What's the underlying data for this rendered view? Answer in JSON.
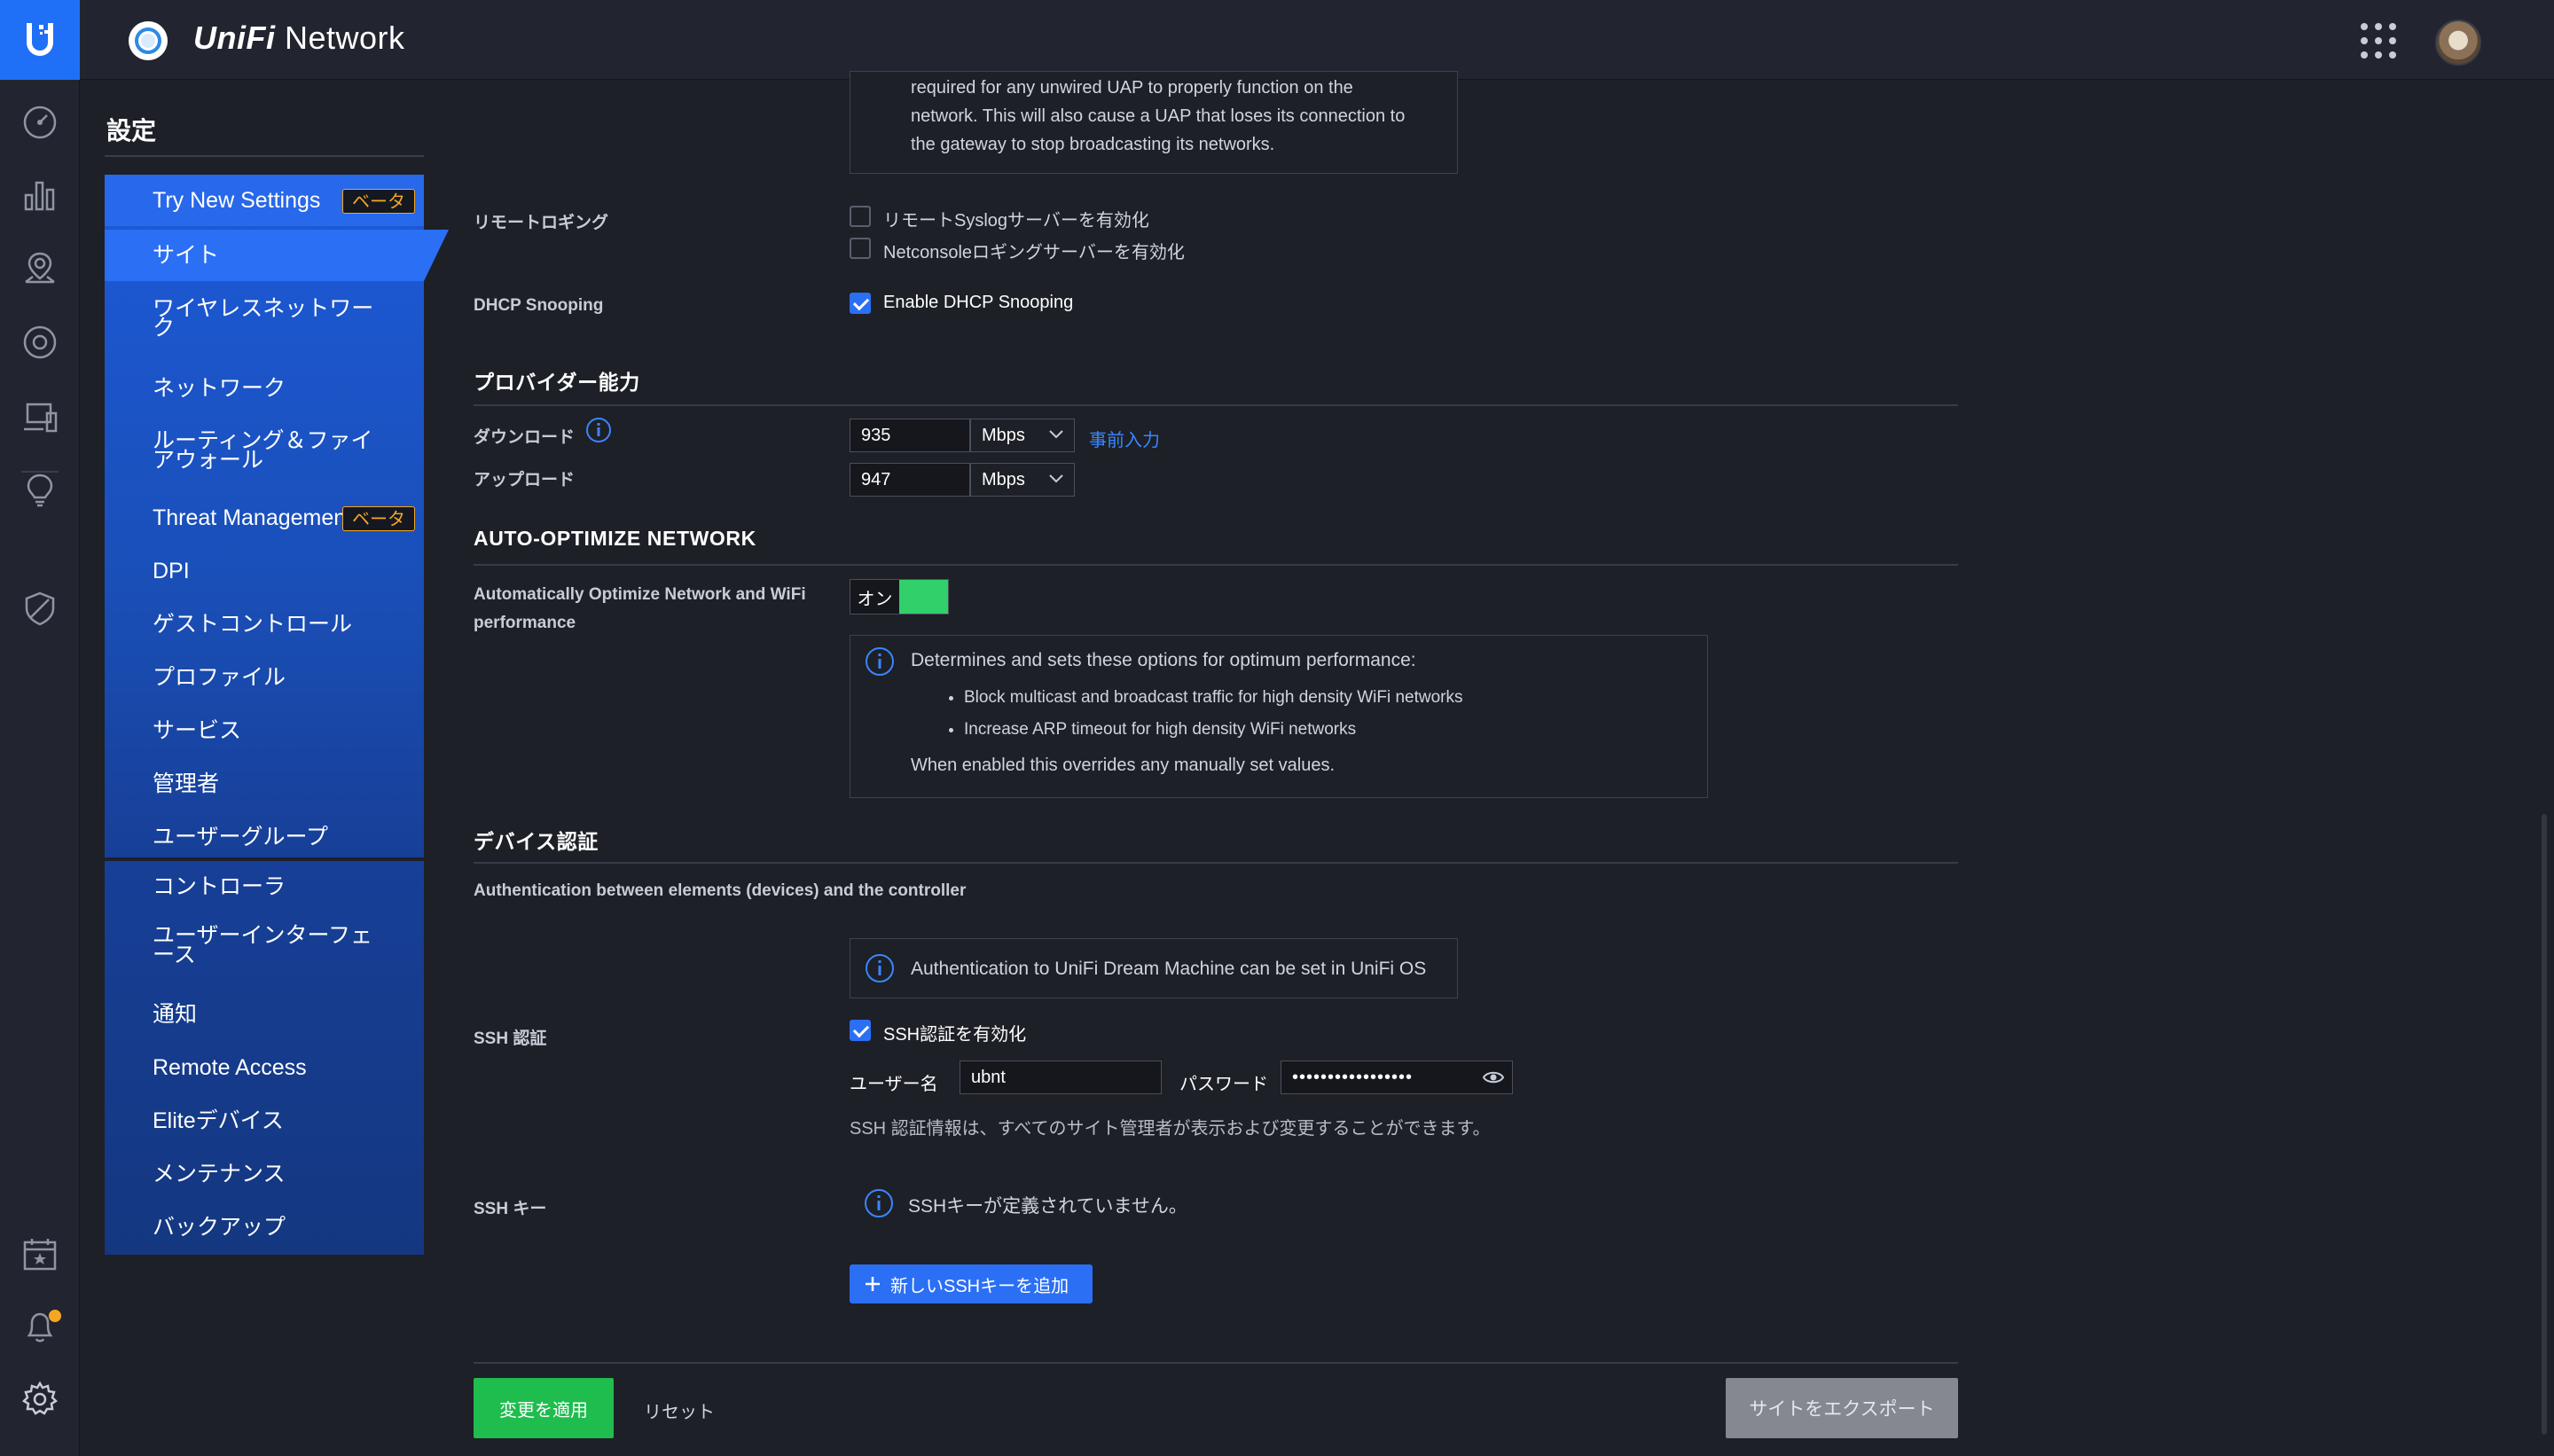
{
  "app": {
    "title_part1": "UniFi",
    "title_part2": " Network"
  },
  "settings_title": "設定",
  "nav": {
    "group1": [
      {
        "label": "Try New Settings",
        "badge": "ベータ"
      },
      {
        "label": "サイト"
      },
      {
        "label": "ワイヤレスネットワーク"
      },
      {
        "label": "ネットワーク"
      },
      {
        "label": "ルーティング＆ファイアウォール"
      },
      {
        "label": "Threat Management",
        "badge": "ベータ"
      },
      {
        "label": "DPI"
      },
      {
        "label": "ゲストコントロール"
      },
      {
        "label": "プロファイル"
      },
      {
        "label": "サービス"
      },
      {
        "label": "管理者"
      },
      {
        "label": "ユーザーグループ"
      }
    ],
    "group2": [
      {
        "label": "コントローラ"
      },
      {
        "label": "ユーザーインターフェース"
      },
      {
        "label": "通知"
      },
      {
        "label": "Remote Access"
      },
      {
        "label": "Eliteデバイス"
      },
      {
        "label": "メンテナンス"
      },
      {
        "label": "バックアップ"
      }
    ]
  },
  "top_note": {
    "line1": "required for any unwired UAP to properly function on the",
    "line2": "network. This will also cause a UAP that loses its connection to",
    "line3": "the gateway to stop broadcasting its networks."
  },
  "remote_logging": {
    "label": "リモートロギング",
    "syslog": {
      "label": "リモートSyslogサーバーを有効化",
      "checked": false
    },
    "netconsole": {
      "label": "Netconsoleロギングサーバーを有効化",
      "checked": false
    }
  },
  "dhcp_snooping": {
    "label": "DHCP Snooping",
    "option": "Enable DHCP Snooping",
    "checked": true
  },
  "provider": {
    "heading": "プロバイダー能力",
    "download_label": "ダウンロード",
    "download_value": "935",
    "download_unit": "Mbps",
    "prefill_link": "事前入力",
    "upload_label": "アップロード",
    "upload_value": "947",
    "upload_unit": "Mbps"
  },
  "auto_optimize": {
    "heading": "AUTO-OPTIMIZE NETWORK",
    "label_line1": "Automatically Optimize Network and WiFi",
    "label_line2": "performance",
    "toggle_label": "オン",
    "toggle_on": true,
    "info_title": "Determines and sets these options for optimum performance:",
    "bullets": [
      "Block multicast and broadcast traffic for high density WiFi networks",
      "Increase ARP timeout for high density WiFi networks"
    ],
    "info_footer": "When enabled this overrides any manually set values."
  },
  "device_auth": {
    "heading": "デバイス認証",
    "subtitle": "Authentication between elements (devices) and the controller",
    "udm_note": "Authentication to UniFi Dream Machine can be set in UniFi OS",
    "ssh_label": "SSH 認証",
    "ssh_enable": "SSH認証を有効化",
    "ssh_checked": true,
    "username_label": "ユーザー名",
    "username_value": "ubnt",
    "password_label": "パスワード",
    "password_value": "•••••••••••••••••",
    "ssh_note": "SSH 認証情報は、すべてのサイト管理者が表示および変更することができます。",
    "ssh_key_label": "SSH キー",
    "ssh_key_empty": "SSHキーが定義されていません。",
    "add_key_button": "新しいSSHキーを追加"
  },
  "footer": {
    "apply": "変更を適用",
    "reset": "リセット",
    "export": "サイトをエクスポート"
  },
  "colors": {
    "accent": "#2b6ff5",
    "apply_green": "#1fbc4e",
    "toggle_green": "#31d06a",
    "beta_orange": "#f6a623",
    "background": "#1d2027"
  },
  "icons": {
    "rail": [
      "dashboard-icon",
      "statistics-icon",
      "map-icon",
      "devices-icon",
      "clients-icon",
      "insights-icon",
      "shield-icon",
      "events-calendar-icon",
      "notifications-bell-icon",
      "settings-gear-icon"
    ]
  }
}
